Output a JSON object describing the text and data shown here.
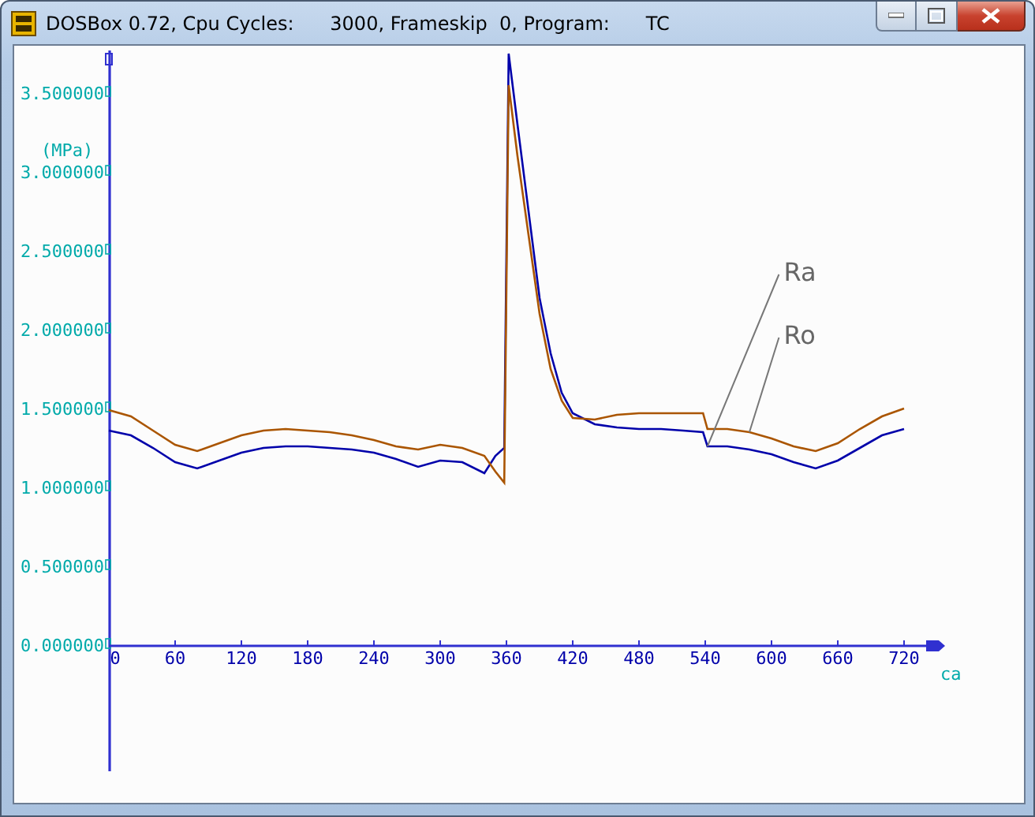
{
  "window": {
    "title": "DOSBox 0.72, Cpu Cycles:      3000, Frameskip  0, Program:      TC"
  },
  "chart_data": {
    "type": "line",
    "xlabel": "ca",
    "ylabel": "(MPa)",
    "x": [
      0,
      20,
      40,
      60,
      80,
      100,
      120,
      140,
      160,
      180,
      200,
      220,
      240,
      260,
      280,
      300,
      320,
      340,
      350,
      358,
      362,
      370,
      380,
      390,
      400,
      410,
      420,
      440,
      460,
      480,
      500,
      520,
      538,
      542,
      560,
      580,
      600,
      620,
      640,
      660,
      680,
      700,
      720
    ],
    "series": [
      {
        "color": "#0000aa",
        "values": [
          1.36,
          1.33,
          1.25,
          1.16,
          1.12,
          1.17,
          1.22,
          1.25,
          1.26,
          1.26,
          1.25,
          1.24,
          1.22,
          1.18,
          1.13,
          1.17,
          1.16,
          1.09,
          1.2,
          1.25,
          3.75,
          3.3,
          2.75,
          2.2,
          1.85,
          1.6,
          1.47,
          1.4,
          1.38,
          1.37,
          1.37,
          1.36,
          1.35,
          1.26,
          1.26,
          1.24,
          1.21,
          1.16,
          1.12,
          1.17,
          1.25,
          1.33,
          1.37
        ]
      },
      {
        "color": "#aa5500",
        "values": [
          1.49,
          1.45,
          1.36,
          1.27,
          1.23,
          1.28,
          1.33,
          1.36,
          1.37,
          1.36,
          1.35,
          1.33,
          1.3,
          1.26,
          1.24,
          1.27,
          1.25,
          1.2,
          1.1,
          1.03,
          3.55,
          3.1,
          2.6,
          2.1,
          1.75,
          1.55,
          1.44,
          1.43,
          1.46,
          1.47,
          1.47,
          1.47,
          1.47,
          1.37,
          1.37,
          1.35,
          1.31,
          1.26,
          1.23,
          1.28,
          1.37,
          1.45,
          1.5
        ]
      }
    ],
    "xlim": [
      0,
      745
    ],
    "ylim": [
      -0.8,
      3.77
    ],
    "xticks": [
      0,
      60,
      120,
      180,
      240,
      300,
      360,
      420,
      480,
      540,
      600,
      660,
      720
    ],
    "yticks": [
      {
        "value": 0,
        "label": "0.000000"
      },
      {
        "value": 0.5,
        "label": "0.500000"
      },
      {
        "value": 1,
        "label": "1.000000"
      },
      {
        "value": 1.5,
        "label": "1.500000"
      },
      {
        "value": 2,
        "label": "2.000000"
      },
      {
        "value": 2.5,
        "label": "2.500000"
      },
      {
        "value": 3,
        "label": "3.000000"
      },
      {
        "value": 3.5,
        "label": "3.500000"
      }
    ],
    "annotations": [
      "Ra",
      "Ro"
    ]
  }
}
